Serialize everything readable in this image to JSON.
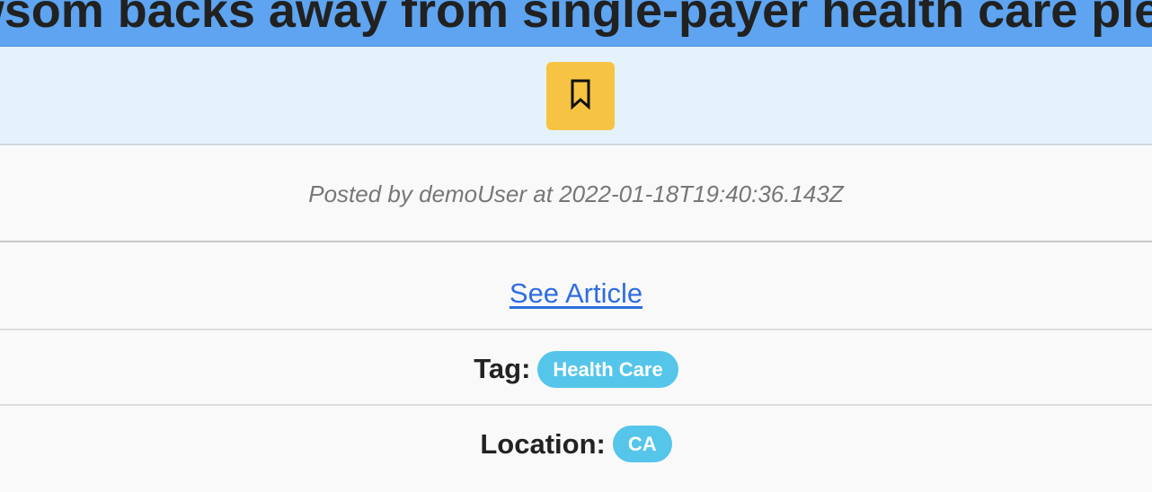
{
  "post": {
    "title": "Newsom backs away from single-payer health care pledge",
    "posted_text": "Posted by demoUser at 2022-01-18T19:40:36.143Z",
    "link_label": "See Article",
    "tag_label": "Tag:",
    "tag_value": "Health Care",
    "location_label": "Location:",
    "location_value": "CA"
  },
  "icons": {
    "bookmark": "bookmark-icon"
  },
  "colors": {
    "title_bar": "#5ea4f0",
    "action_bar": "#e4f2fb",
    "bookmark_button": "#f6c442",
    "link": "#2f6de0",
    "pill": "#55c5ea"
  }
}
